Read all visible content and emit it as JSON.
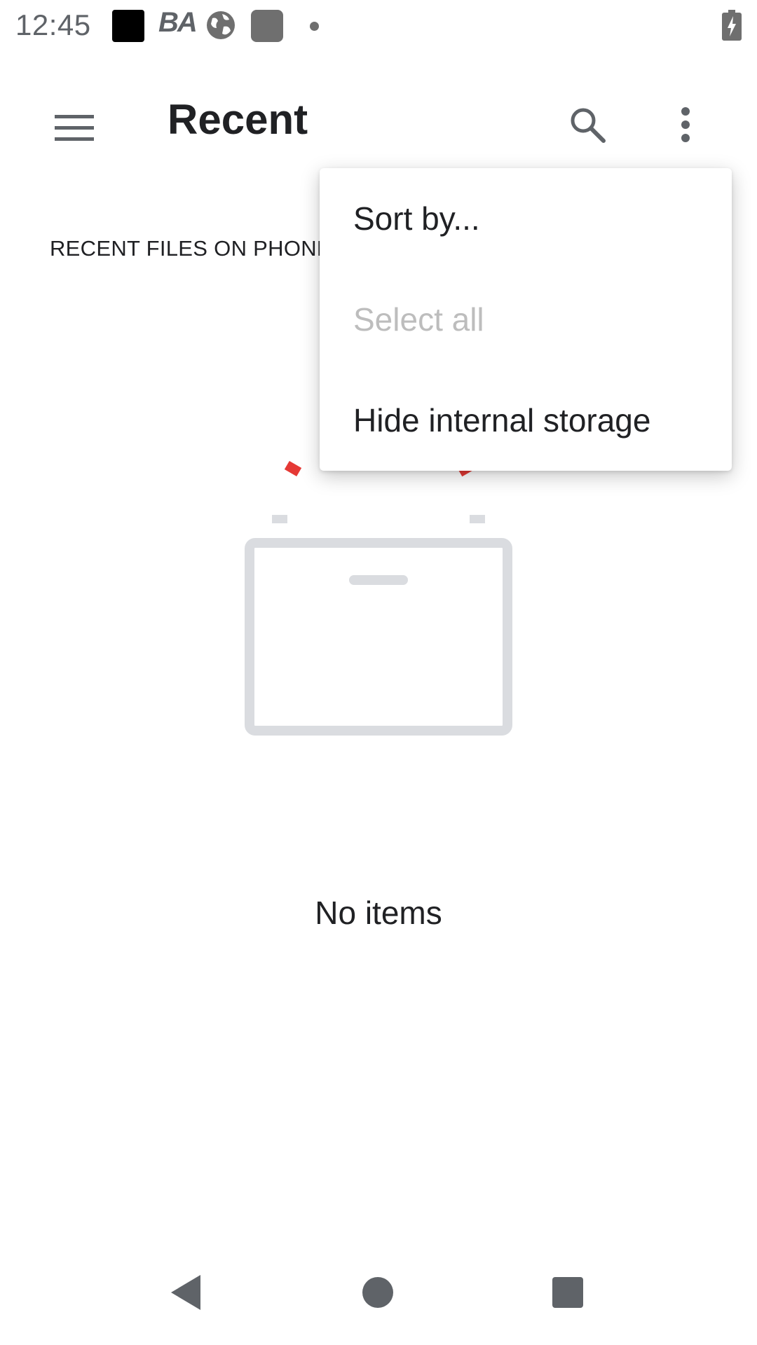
{
  "status_bar": {
    "time": "12:45",
    "ba_text": "BA",
    "icons": [
      "black-square-icon",
      "ba-icon",
      "globe-icon",
      "gray-square-icon",
      "dot-icon",
      "battery-charging-icon"
    ]
  },
  "app_bar": {
    "title": "Recent",
    "menu_icon": "hamburger-menu-icon",
    "search_icon": "search-icon",
    "more_icon": "more-vert-icon"
  },
  "section_header": "RECENT FILES ON PHONE",
  "empty_state": {
    "text": "No items",
    "illustration": "empty-box-illustration"
  },
  "overflow_menu": {
    "items": [
      {
        "label": "Sort by...",
        "enabled": true
      },
      {
        "label": "Select all",
        "enabled": false
      },
      {
        "label": "Hide internal storage",
        "enabled": true
      }
    ]
  },
  "nav_bar": {
    "icons": [
      "back-icon",
      "home-icon",
      "recents-icon"
    ]
  },
  "colors": {
    "accent": "#e53935",
    "icon_gray": "#5f6368",
    "illustration_gray": "#dadce0",
    "disabled_text": "#bdbdbd"
  }
}
